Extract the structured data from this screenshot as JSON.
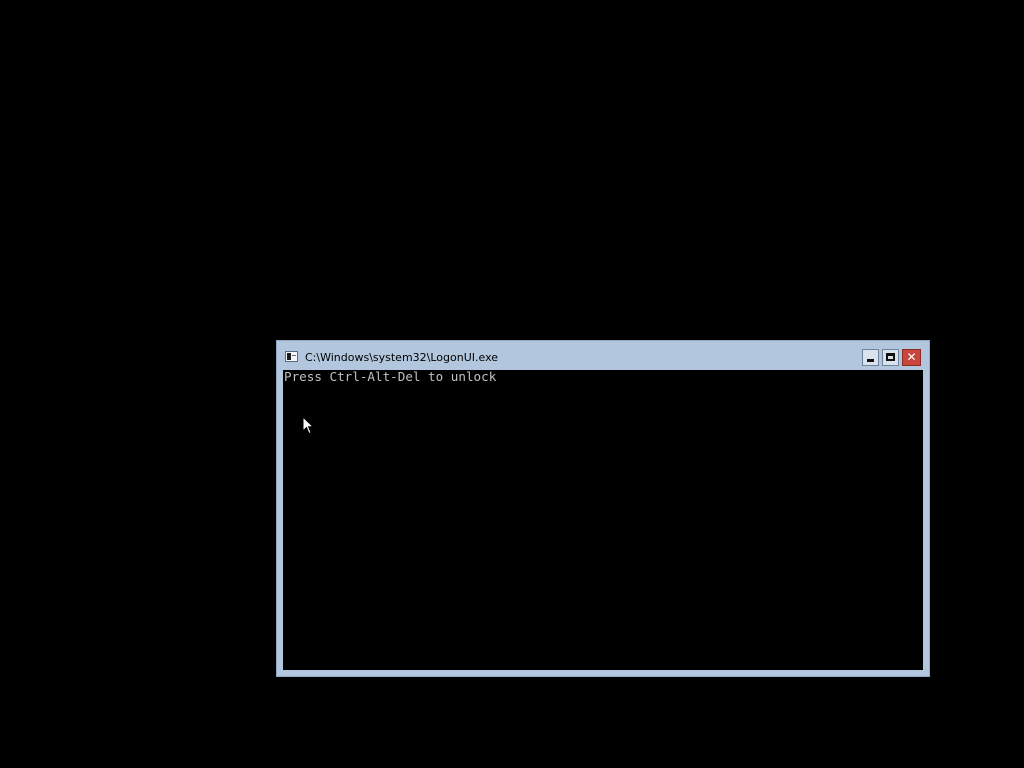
{
  "window": {
    "title": "C:\\Windows\\system32\\LogonUI.exe",
    "app_icon": "console-app-icon",
    "controls": {
      "minimize_icon": "minimize-icon",
      "maximize_icon": "maximize-icon",
      "close_icon": "close-icon",
      "close_glyph": "✕"
    }
  },
  "console": {
    "lines": [
      "Press Ctrl-Alt-Del to unlock"
    ],
    "text_color": "#c0c0c0",
    "background": "#000000"
  },
  "desktop": {
    "background": "#000000",
    "cursor_icon": "mouse-pointer-icon"
  },
  "colors": {
    "window_frame": "#b2c7de",
    "close_button": "#c8473d"
  }
}
